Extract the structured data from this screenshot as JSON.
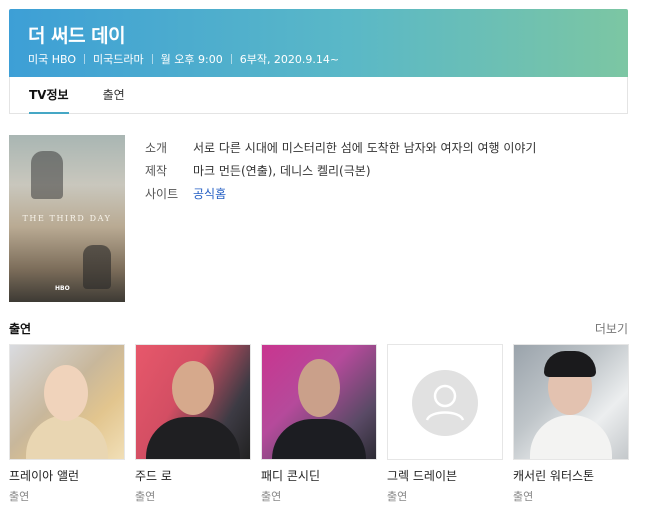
{
  "header": {
    "title": "더 써드 데이",
    "meta": [
      "미국 HBO",
      "미국드라마",
      "월 오후 9:00",
      "6부작, 2020.9.14~"
    ]
  },
  "tabs": [
    {
      "label": "TV정보",
      "active": true
    },
    {
      "label": "출연",
      "active": false
    }
  ],
  "poster": {
    "title_text": "THE THIRD DAY",
    "logo_text": "HBO"
  },
  "info": {
    "synopsis_label": "소개",
    "synopsis": "서로 다른 시대에 미스터리한 섬에 도착한 남자와 여자의 여행 이야기",
    "production_label": "제작",
    "production": "마크 먼든(연출), 데니스 켈리(극본)",
    "site_label": "사이트",
    "site_link": "공식홈"
  },
  "cast_section": {
    "title": "출연",
    "more_label": "더보기",
    "members": [
      {
        "name": "프레이아 앨런",
        "role": "출연"
      },
      {
        "name": "주드 로",
        "role": "출연"
      },
      {
        "name": "패디 콘시딘",
        "role": "출연"
      },
      {
        "name": "그렉 드레이븐",
        "role": "출연"
      },
      {
        "name": "캐서린 워터스톤",
        "role": "출연"
      }
    ]
  },
  "colors": {
    "accent": "#45a7c5",
    "link": "#245fc4",
    "header_start": "#3d9fd6",
    "header_end": "#7cc6a3"
  }
}
